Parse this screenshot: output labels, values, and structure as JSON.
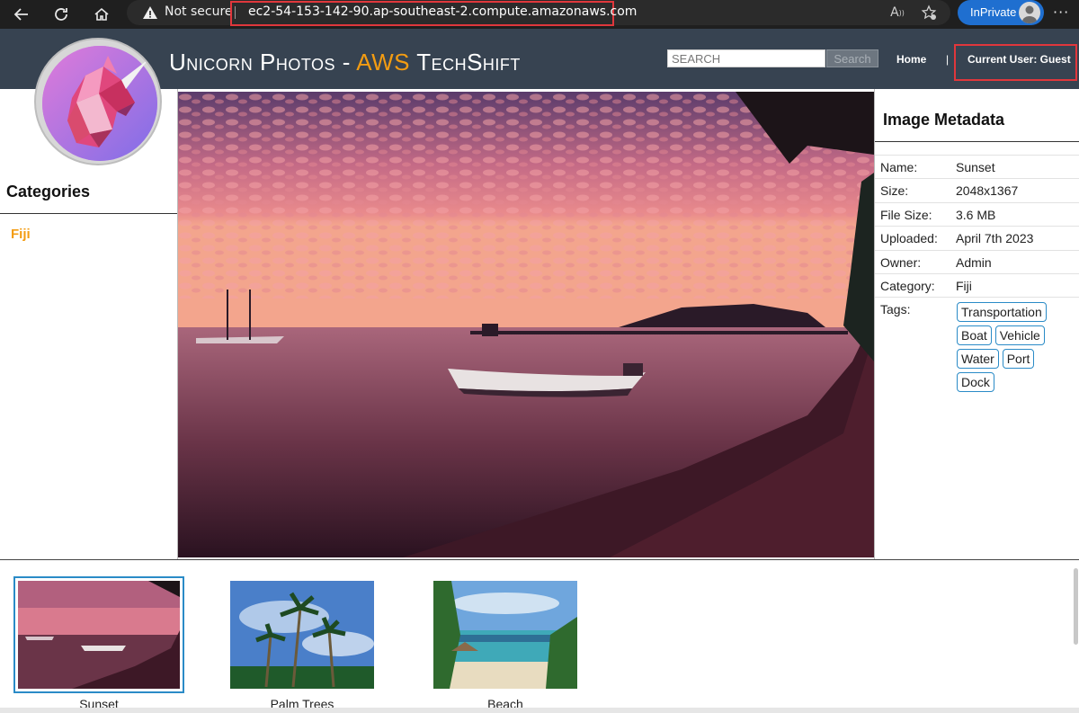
{
  "browser": {
    "not_secure": "Not secure",
    "url": "ec2-54-153-142-90.ap-southeast-2.compute.amazonaws.com",
    "inprivate": "InPrivate"
  },
  "header": {
    "title_main": "Unicorn Photos - ",
    "title_accent": "AWS",
    "title_end": " TechShift",
    "search_placeholder": "SEARCH",
    "search_button": "Search",
    "home": "Home",
    "separator": "|",
    "current_user": "Current User: Guest",
    "accent_color": "#f39c12",
    "header_bg": "#374351"
  },
  "sidebar": {
    "title": "Categories",
    "items": [
      {
        "label": "Fiji"
      }
    ]
  },
  "metadata": {
    "title": "Image Metadata",
    "rows": [
      {
        "key": "Name:",
        "value": "Sunset"
      },
      {
        "key": "Size:",
        "value": "2048x1367"
      },
      {
        "key": "File Size:",
        "value": "3.6 MB"
      },
      {
        "key": "Uploaded:",
        "value": "April 7th 2023"
      },
      {
        "key": "Owner:",
        "value": "Admin"
      },
      {
        "key": "Category:",
        "value": "Fiji"
      }
    ],
    "tags_label": "Tags:",
    "tags": [
      "Transportation",
      "Boat",
      "Vehicle",
      "Water",
      "Port",
      "Dock"
    ]
  },
  "thumbnails": [
    {
      "caption": "Sunset",
      "selected": true
    },
    {
      "caption": "Palm Trees",
      "selected": false
    },
    {
      "caption": "Beach",
      "selected": false
    }
  ]
}
